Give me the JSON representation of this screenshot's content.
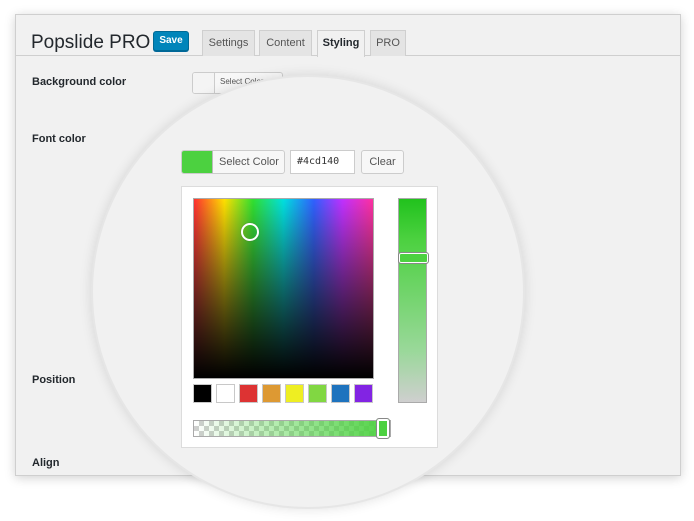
{
  "app": {
    "title": "Popslide PRO",
    "save_label": "Save"
  },
  "tabs": [
    {
      "label": "Settings",
      "active": false
    },
    {
      "label": "Content",
      "active": false
    },
    {
      "label": "Styling",
      "active": true
    },
    {
      "label": "PRO",
      "active": false
    }
  ],
  "fields": {
    "background_color": {
      "label": "Background color",
      "button_label": "Select Color",
      "button_label_overlap": "olor"
    },
    "font_color": {
      "label": "Font color",
      "button_label": "Select Color",
      "value": "#4cd140",
      "clear_label": "Clear"
    },
    "position": {
      "label": "Position"
    },
    "align": {
      "label": "Align"
    }
  },
  "color_picker": {
    "current_color": "#4cd140",
    "palette": [
      "#000000",
      "#ffffff",
      "#dd3333",
      "#dd9933",
      "#eeee22",
      "#81d742",
      "#1e73be",
      "#8224e3"
    ],
    "lightness_level": 0.72,
    "alpha_level": 1.0
  },
  "colors": {
    "accent": "#0085ba",
    "active_outline": "#2e8bc0"
  }
}
